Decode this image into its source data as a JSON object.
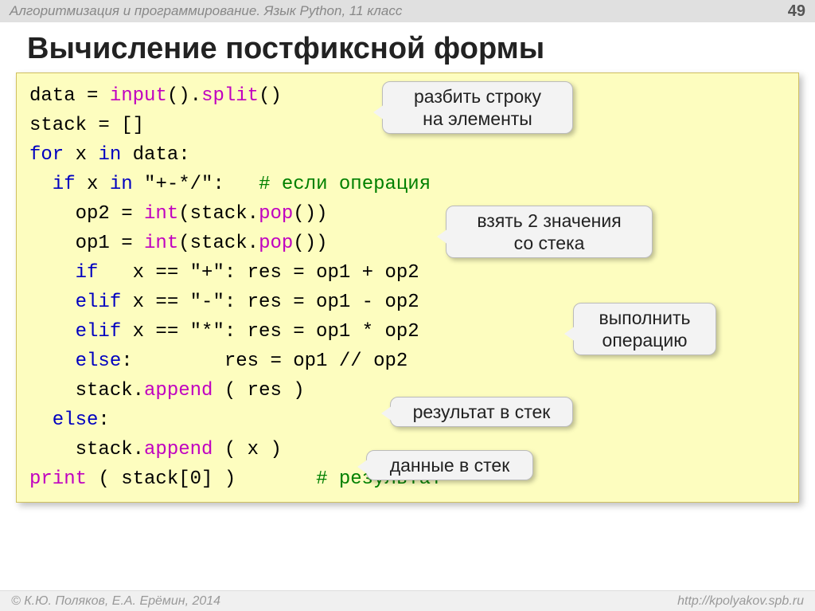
{
  "header": {
    "subject": "Алгоритмизация и программирование. Язык Python, 11 класс",
    "page": "49"
  },
  "title": "Вычисление постфиксной формы",
  "code": {
    "l1a": "data = ",
    "l1b": "input",
    "l1c": "().",
    "l1d": "split",
    "l1e": "()",
    "l2": "stack = []",
    "l3a": "for",
    "l3b": " x ",
    "l3c": "in",
    "l3d": " data:",
    "l4a": "  if",
    "l4b": " x ",
    "l4c": "in",
    "l4d": " \"+-*/\":   ",
    "l4e": "# если операция",
    "l5a": "    op2 = ",
    "l5b": "int",
    "l5c": "(stack.",
    "l5d": "pop",
    "l5e": "())",
    "l6a": "    op1 = ",
    "l6b": "int",
    "l6c": "(stack.",
    "l6d": "pop",
    "l6e": "())",
    "l7a": "    if",
    "l7b": "   x == \"+\": res = op1 + op2",
    "l8a": "    elif",
    "l8b": " x == \"-\": res = op1 - op2",
    "l9a": "    elif",
    "l9b": " x == \"*\": res = op1 * op2",
    "l10a": "    else",
    "l10b": ":        res = op1 // op2",
    "l11a": "    stack.",
    "l11b": "append",
    "l11c": " ( res )",
    "l12a": "  else",
    "l12b": ":",
    "l13a": "    stack.",
    "l13b": "append",
    "l13c": " ( x )",
    "l14a": "print",
    "l14b": " ( stack[0] )       ",
    "l14c": "# результат"
  },
  "callouts": {
    "c1": "разбить строку\nна элементы",
    "c2": "взять 2 значения\nсо стека",
    "c3": "выполнить\nоперацию",
    "c4": "результат в стек",
    "c5": "данные в стек"
  },
  "footer": {
    "left": "© К.Ю. Поляков, Е.А. Ерёмин, 2014",
    "right": "http://kpolyakov.spb.ru"
  }
}
